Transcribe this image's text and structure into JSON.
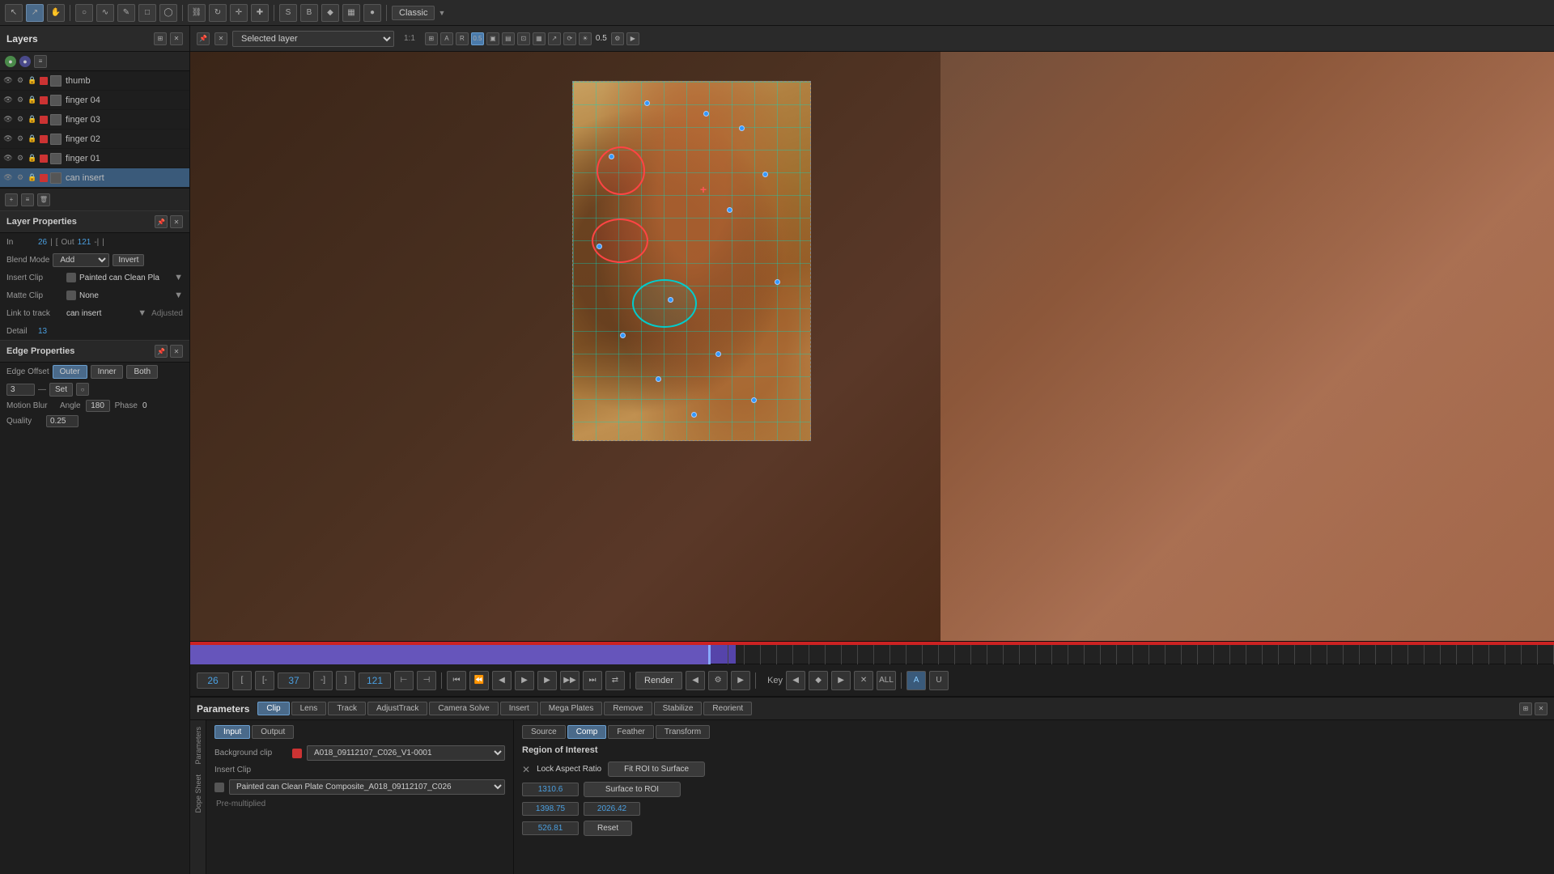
{
  "app": {
    "mode": "Classic",
    "toolbar_icons": [
      "arrow",
      "arrow2",
      "grab",
      "circle",
      "lasso",
      "pen",
      "rect",
      "oval",
      "link",
      "rotate",
      "move",
      "cross",
      "S-icon",
      "B-icon",
      "diamond",
      "circle2",
      "settings"
    ]
  },
  "viewer_toolbar": {
    "layer_select": "Selected layer",
    "zoom": "1:1",
    "exposure": "0.5"
  },
  "layers": {
    "title": "Layers",
    "items": [
      {
        "name": "thumb",
        "selected": false
      },
      {
        "name": "finger 04",
        "selected": false
      },
      {
        "name": "finger 03",
        "selected": false
      },
      {
        "name": "finger 02",
        "selected": false
      },
      {
        "name": "finger 01",
        "selected": false
      },
      {
        "name": "can insert",
        "selected": true
      }
    ]
  },
  "layer_properties": {
    "title": "Layer Properties",
    "in_label": "In",
    "in_value": "26",
    "out_label": "Out",
    "out_value": "121",
    "blend_mode_label": "Blend Mode",
    "blend_mode_value": "Add",
    "invert_label": "Invert",
    "insert_clip_label": "Insert Clip",
    "insert_clip_value": "Painted can Clean Pla",
    "matte_clip_label": "Matte Clip",
    "matte_clip_value": "None",
    "link_to_track_label": "Link to track",
    "link_to_track_value": "can insert",
    "adjusted_label": "Adjusted",
    "detail_label": "Detail",
    "detail_value": "13"
  },
  "edge_properties": {
    "title": "Edge Properties",
    "offset_label": "Edge Offset",
    "outer_label": "Outer",
    "inner_label": "Inner",
    "both_label": "Both",
    "offset_value": "3",
    "set_label": "Set",
    "motion_blur_label": "Motion Blur",
    "angle_label": "Angle",
    "angle_value": "180",
    "phase_label": "Phase",
    "phase_value": "0",
    "quality_label": "Quality",
    "quality_value": "0.25"
  },
  "timeline": {
    "in_point": "26",
    "bracket_in": "[",
    "minus_bracket": "[-",
    "current_frame": "37",
    "plus_bracket": "-]",
    "bracket_out": "]",
    "out_point": "121",
    "render_label": "Render",
    "key_label": "Key"
  },
  "params": {
    "title": "Parameters",
    "tabs": [
      {
        "label": "Clip",
        "active": true
      },
      {
        "label": "Lens",
        "active": false
      },
      {
        "label": "Track",
        "active": false
      },
      {
        "label": "AdjustTrack",
        "active": false
      },
      {
        "label": "Camera Solve",
        "active": false
      },
      {
        "label": "Insert",
        "active": false
      },
      {
        "label": "Mega Plates",
        "active": false
      },
      {
        "label": "Remove",
        "active": false
      },
      {
        "label": "Stabilize",
        "active": false
      },
      {
        "label": "Reorient",
        "active": false
      }
    ],
    "subtabs_input_output": [
      {
        "label": "Input",
        "active": true
      },
      {
        "label": "Output",
        "active": false
      }
    ],
    "background_clip_label": "Background clip",
    "background_clip_value": "A018_09112107_C026_V1-0001",
    "insert_clip_label": "Insert Clip",
    "insert_clip_value": "Painted can Clean Plate Composite_A018_09112107_C026",
    "premultiplied_label": "Pre-multiplied",
    "roi_subtabs": [
      {
        "label": "Source",
        "active": false
      },
      {
        "label": "Comp",
        "active": true
      },
      {
        "label": "Feather",
        "active": false
      },
      {
        "label": "Transform",
        "active": false
      }
    ],
    "roi_section": "Region of Interest",
    "lock_aspect_ratio": "Lock Aspect Ratio",
    "fit_roi_label": "Fit ROI to Surface",
    "fit_surface_label": "Surface to ROI",
    "roi_x": "1310.6",
    "roi_w": "1398.75",
    "roi_h": "2026.42",
    "roi_y": "526.81",
    "reset_label": "Reset",
    "vertical_tabs": [
      "Parameters",
      "Dope Sheet"
    ]
  }
}
